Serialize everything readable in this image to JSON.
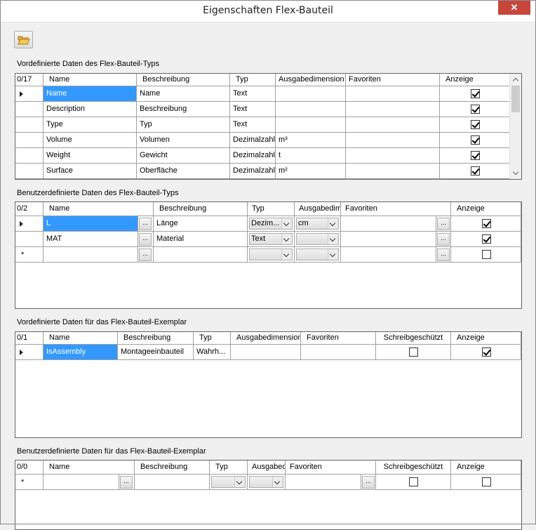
{
  "window": {
    "title": "Eigenschaften Flex-Bauteil",
    "close_label": "✕"
  },
  "toolbar": {
    "open_icon": "folder-open-icon"
  },
  "sections": [
    {
      "label": "Vordefinierte Daten des Flex-Bauteil-Typs",
      "count": "0/17",
      "headers": [
        "Name",
        "Beschreibung",
        "Typ",
        "Ausgabedimension",
        "Favoriten",
        "Anzeige"
      ],
      "rows": [
        [
          "Name",
          "Name",
          "Text",
          "",
          "",
          true
        ],
        [
          "Description",
          "Beschreibung",
          "Text",
          "",
          "",
          true
        ],
        [
          "Type",
          "Typ",
          "Text",
          "",
          "",
          true
        ],
        [
          "Volume",
          "Volumen",
          "Dezimalzahl",
          "m³",
          "",
          true
        ],
        [
          "Weight",
          "Gewicht",
          "Dezimalzahl",
          "t",
          "",
          true
        ],
        [
          "Surface",
          "Oberfläche",
          "Dezimalzahl",
          "m²",
          "",
          true
        ]
      ]
    },
    {
      "label": "Benutzerdefinierte Daten des Flex-Bauteil-Typs",
      "count": "0/2",
      "headers": [
        "Name",
        "Beschreibung",
        "Typ",
        "Ausgabedim",
        "Favoriten",
        "Anzeige"
      ],
      "ellipsis": "...",
      "rows": [
        [
          "L",
          "Länge",
          "Dezim...",
          "cm",
          "",
          true
        ],
        [
          "MAT",
          "Material",
          "Text",
          "",
          "",
          true
        ],
        [
          "",
          "",
          "",
          "",
          "",
          false
        ]
      ],
      "new_row_marker": "*"
    },
    {
      "label": "Vordefinierte Daten für das Flex-Bauteil-Exemplar",
      "count": "0/1",
      "headers": [
        "Name",
        "Beschreibung",
        "Typ",
        "Ausgabedimension",
        "Favoriten",
        "Schreibgeschützt",
        "Anzeige"
      ],
      "rows": [
        [
          "IsAssembly",
          "Montageeinbauteil",
          "Wahrh...",
          "",
          "",
          false,
          true
        ]
      ]
    },
    {
      "label": "Benutzerdefinierte Daten für das Flex-Bauteil-Exemplar",
      "count": "0/0",
      "headers": [
        "Name",
        "Beschreibung",
        "Typ",
        "Ausgabec",
        "Favoriten",
        "Schreibgeschützt",
        "Anzeige"
      ],
      "ellipsis": "...",
      "rows": [
        [
          "",
          "",
          "",
          "",
          "",
          false,
          false
        ]
      ],
      "new_row_marker": "*"
    }
  ]
}
